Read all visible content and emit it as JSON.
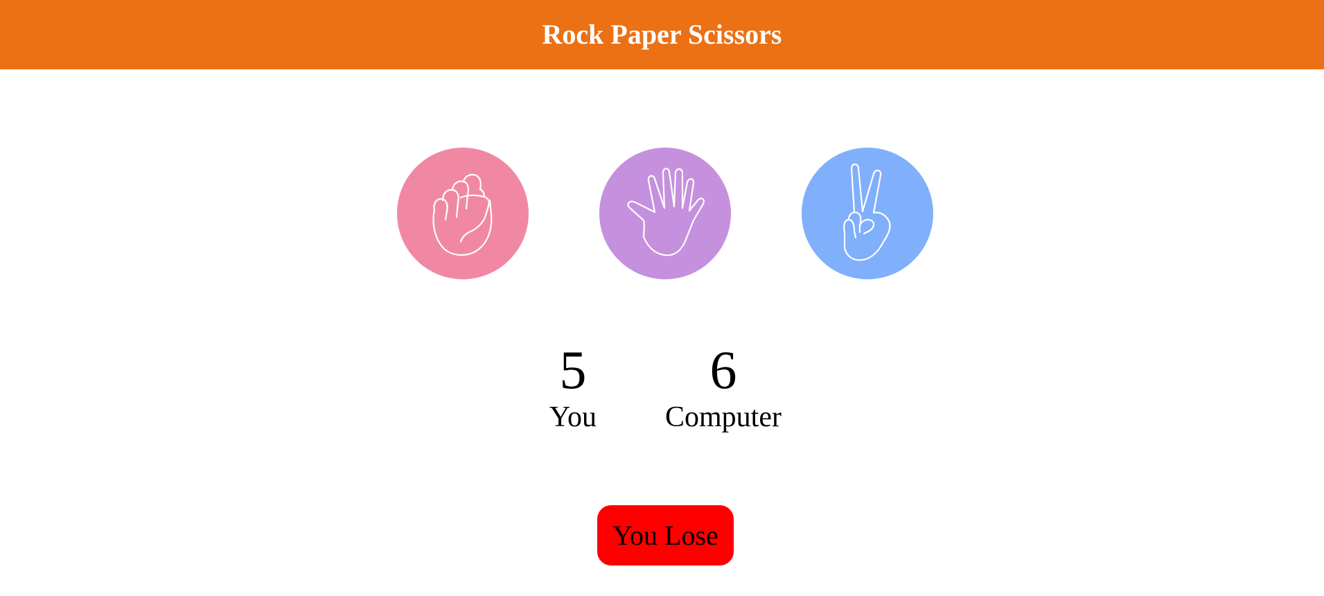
{
  "header": {
    "title": "Rock Paper Scissors",
    "background": "#ec7014"
  },
  "choices": [
    {
      "name": "rock",
      "icon": "fist-icon",
      "color": "#f088a4"
    },
    {
      "name": "paper",
      "icon": "open-hand-icon",
      "color": "#c590dd"
    },
    {
      "name": "scissors",
      "icon": "peace-sign-icon",
      "color": "#80affc"
    }
  ],
  "scores": {
    "you": {
      "value": "5",
      "label": "You"
    },
    "computer": {
      "value": "6",
      "label": "Computer"
    }
  },
  "result": {
    "text": "You Lose",
    "color": "#ff0000"
  }
}
